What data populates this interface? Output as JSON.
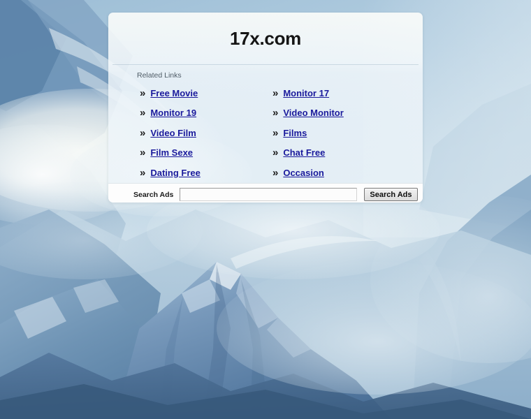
{
  "page": {
    "domain_title": "17x.com",
    "related_label": "Related Links"
  },
  "links": {
    "bullet": "»",
    "left_column": [
      {
        "label": "Free Movie"
      },
      {
        "label": "Monitor 19"
      },
      {
        "label": "Video Film"
      },
      {
        "label": "Film Sexe"
      },
      {
        "label": "Dating Free"
      }
    ],
    "right_column": [
      {
        "label": "Monitor 17"
      },
      {
        "label": "Video Monitor"
      },
      {
        "label": "Films"
      },
      {
        "label": "Chat Free"
      },
      {
        "label": "Occasion"
      }
    ]
  },
  "search": {
    "label": "Search Ads",
    "value": "",
    "placeholder": "",
    "button_label": "Search Ads"
  },
  "colors": {
    "link": "#1a1a9c",
    "title": "#151515",
    "card_bg": "#f4f8fb",
    "footer_bg": "#fdfdfd",
    "background_sky": "#a8c6dc",
    "background_mountain": "#5f87ad"
  },
  "background": {
    "description": "snow-covered mountain peaks with clouds"
  }
}
